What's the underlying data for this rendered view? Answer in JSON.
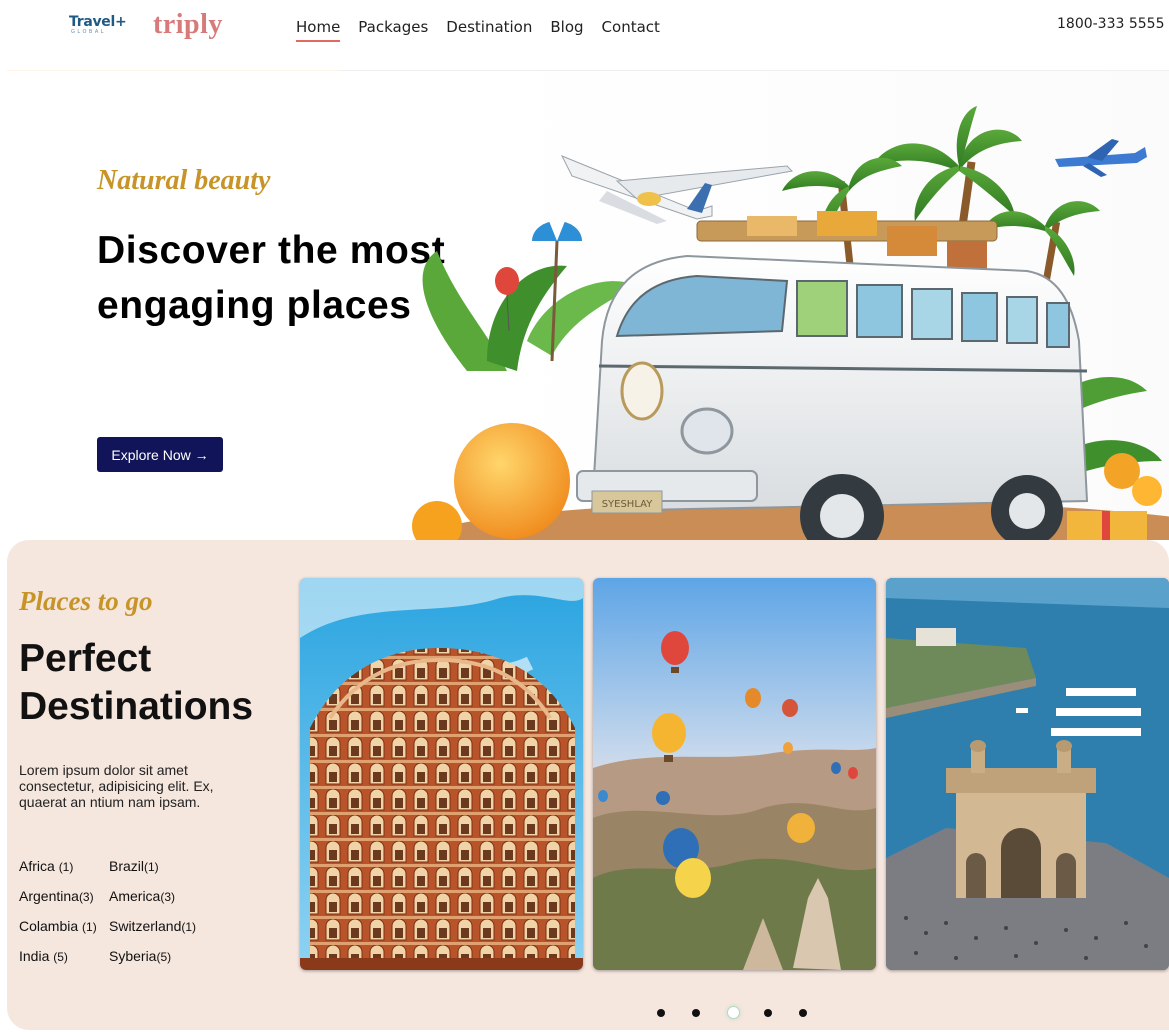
{
  "header": {
    "logo_mark": "Travel+",
    "logo_mark_sub": "GLOBAL",
    "logo_text": "triply",
    "nav": [
      {
        "label": "Home",
        "active": true
      },
      {
        "label": "Packages",
        "active": false
      },
      {
        "label": "Destination",
        "active": false
      },
      {
        "label": "Blog",
        "active": false
      },
      {
        "label": "Contact",
        "active": false
      }
    ],
    "phone": "1800-333 5555"
  },
  "hero": {
    "eyebrow": "Natural beauty",
    "title": "Discover the most engaging places",
    "cta_label": "Explore Now →",
    "bus_plate": "SYESHLAY"
  },
  "destinations": {
    "eyebrow": "Places to go",
    "title": "Perfect Destinations",
    "description": "Lorem ipsum dolor sit amet consectetur, adipisicing elit. Ex, quaerat an ntium nam ipsam.",
    "regions": [
      {
        "name": "Africa",
        "count": "(1)"
      },
      {
        "name": "Brazil",
        "count": "(1)"
      },
      {
        "name": "Argentina",
        "count": "(3)"
      },
      {
        "name": "America",
        "count": "(3)"
      },
      {
        "name": "Colambia",
        "count": "(1)"
      },
      {
        "name": "Switzerland",
        "count": "(1)"
      },
      {
        "name": "India",
        "count": "(5)"
      },
      {
        "name": "Syberia",
        "count": "(5)"
      }
    ],
    "cards": [
      {
        "name": "palace-card",
        "subject": "pink palace facade"
      },
      {
        "name": "balloons-card",
        "subject": "hot air balloons over valley"
      },
      {
        "name": "gateway-card",
        "subject": "harbour gateway monument"
      }
    ],
    "carousel": {
      "total": 5,
      "active": 3
    }
  },
  "colors": {
    "accent": "#c79428",
    "button": "#12145a",
    "logo": "#d97a7a",
    "section_bg": "#f5e6de",
    "nav_underline": "#e06a5f"
  }
}
